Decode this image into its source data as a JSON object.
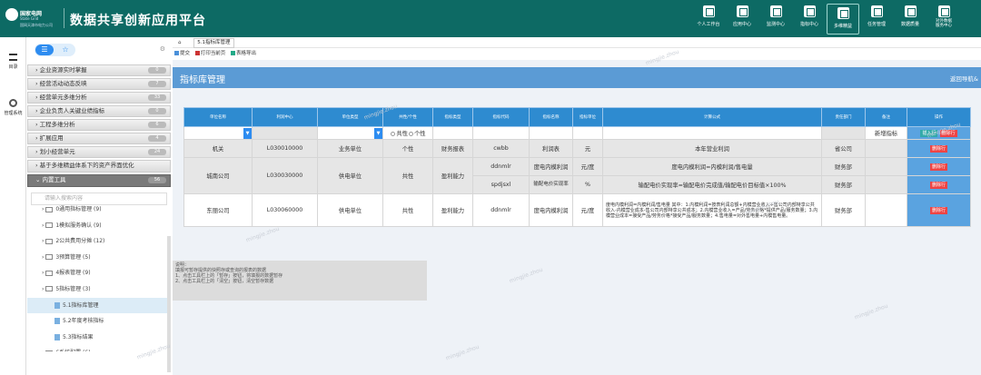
{
  "brand": {
    "logo_line1": "国家电网",
    "logo_line2": "State Grid",
    "logo_line3": "国网天津市电力公司",
    "app_title": "数据共享创新应用平台"
  },
  "nav": [
    {
      "label": "个人工作台",
      "icon": "monitor-icon"
    },
    {
      "label": "应用中心",
      "icon": "edit-icon"
    },
    {
      "label": "监测中心",
      "icon": "frame-icon"
    },
    {
      "label": "指标中心",
      "icon": "list-icon"
    },
    {
      "label": "多维精益",
      "icon": "document-icon",
      "active": true
    },
    {
      "label": "任务管理",
      "icon": "task-icon"
    },
    {
      "label": "数据质量",
      "icon": "camera-icon"
    },
    {
      "label": "对外数据\n服务中心",
      "icon": "share-icon"
    }
  ],
  "leftnav": {
    "catalog": "目录",
    "manage": "管理系统"
  },
  "side": {
    "menus": [
      {
        "label": "企业资源实时掌握",
        "count": "0"
      },
      {
        "label": "经营活动动态反映",
        "count": "7"
      },
      {
        "label": "经营单元多维分析",
        "count": "33"
      },
      {
        "label": "企业负责人关键业绩指标",
        "count": "0"
      },
      {
        "label": "工程多维分析",
        "count": "6"
      },
      {
        "label": "扩展应用",
        "count": "4"
      },
      {
        "label": "划小经营单元",
        "count": "24"
      },
      {
        "label": "基于多维精益体系下的资产界面优化",
        "count": "0"
      }
    ],
    "tools_label": "内置工具",
    "tools_count": "56",
    "search_placeholder": "请输入搜索内容",
    "tree": [
      {
        "label": "0通用指标管理 (9)",
        "level": 0
      },
      {
        "label": "1模拟服务确认 (9)",
        "level": 0
      },
      {
        "label": "2公共费用分摊 (12)",
        "level": 0
      },
      {
        "label": "3预算管理 (5)",
        "level": 0
      },
      {
        "label": "4报表管理 (9)",
        "level": 0
      },
      {
        "label": "5指标管理 (3)",
        "level": 0
      },
      {
        "label": "5.1指标库管理",
        "level": 1,
        "selected": true
      },
      {
        "label": "5.2年度考核指标",
        "level": 1
      },
      {
        "label": "5.3指标结果",
        "level": 1
      },
      {
        "label": "6系统配置 (6)",
        "level": 0
      }
    ]
  },
  "main": {
    "crumb_tab": "5.1指标库管理",
    "toolbar": [
      "提交",
      "打印当前页",
      "表格导出"
    ],
    "title": "指标库管理",
    "back": "返回导航&",
    "columns": [
      "单位名称",
      "利润中心",
      "单位类型",
      "共性/个性",
      "指标类型",
      "指标代码",
      "指标名称",
      "指标单位",
      "计算公式",
      "责任部门",
      "备注",
      "操作"
    ],
    "input_row": {
      "radio1": "共性",
      "radio2": "个性",
      "remark": "新增指标",
      "add": "插入行",
      "del": "删除行"
    },
    "rows": [
      {
        "unit": "机关",
        "profit": "L030010000",
        "type": "业务单位",
        "nature": "个性",
        "kind": "财务报表",
        "code": "cwbb",
        "name": "利润表",
        "measure": "元",
        "formula": "本年营业利润",
        "dept": "省公司",
        "op": "删除行"
      },
      {
        "unit": "城南公司",
        "profit": "L030030000",
        "type": "供电单位",
        "nature": "共性",
        "kind": "盈利能力",
        "code": "ddnmlr",
        "name": "度电内模利润",
        "measure": "元/度",
        "formula": "度电内模利润=内模利润/售电量",
        "dept": "财务部",
        "op": "删除行"
      },
      {
        "unit": "",
        "profit": "",
        "type": "",
        "nature": "",
        "kind": "",
        "code": "spdjsxl",
        "name": "输配电价实现率",
        "measure": "%",
        "formula": "输配电价实现率=输配电价完成值/输配电价目标值×100%",
        "dept": "财务部",
        "op": "删除行"
      },
      {
        "unit": "东丽公司",
        "profit": "L030060000",
        "type": "供电单位",
        "nature": "共性",
        "kind": "盈利能力",
        "code": "ddnmlr",
        "name": "度电内模利润",
        "measure": "元/度",
        "formula": "度电内模利润=内模利润/售电量 其中：1.内模利润=按表利润总额+内模营业收入+售公司内部特享公共收入-内模营业成本-售公司内部特享公共成本；2.内模营业收入=产品/劳务价格*提供产品/服务数量；3.内模营业成本=接受产品/劳务价格*接受产品/服务数量；4.售电量=对外售电量+内模售电量。",
        "dept": "财务部",
        "op": "删除行"
      }
    ],
    "note": "说明：\n填报可暂存提供的快照存或查询的报表的数据\n1、点击工具栏上的「暂存」按钮，将填报的数据暂存\n2、点击工具栏上的「清空」按钮，清空暂存数据"
  },
  "watermark": "mingjie.zhou"
}
